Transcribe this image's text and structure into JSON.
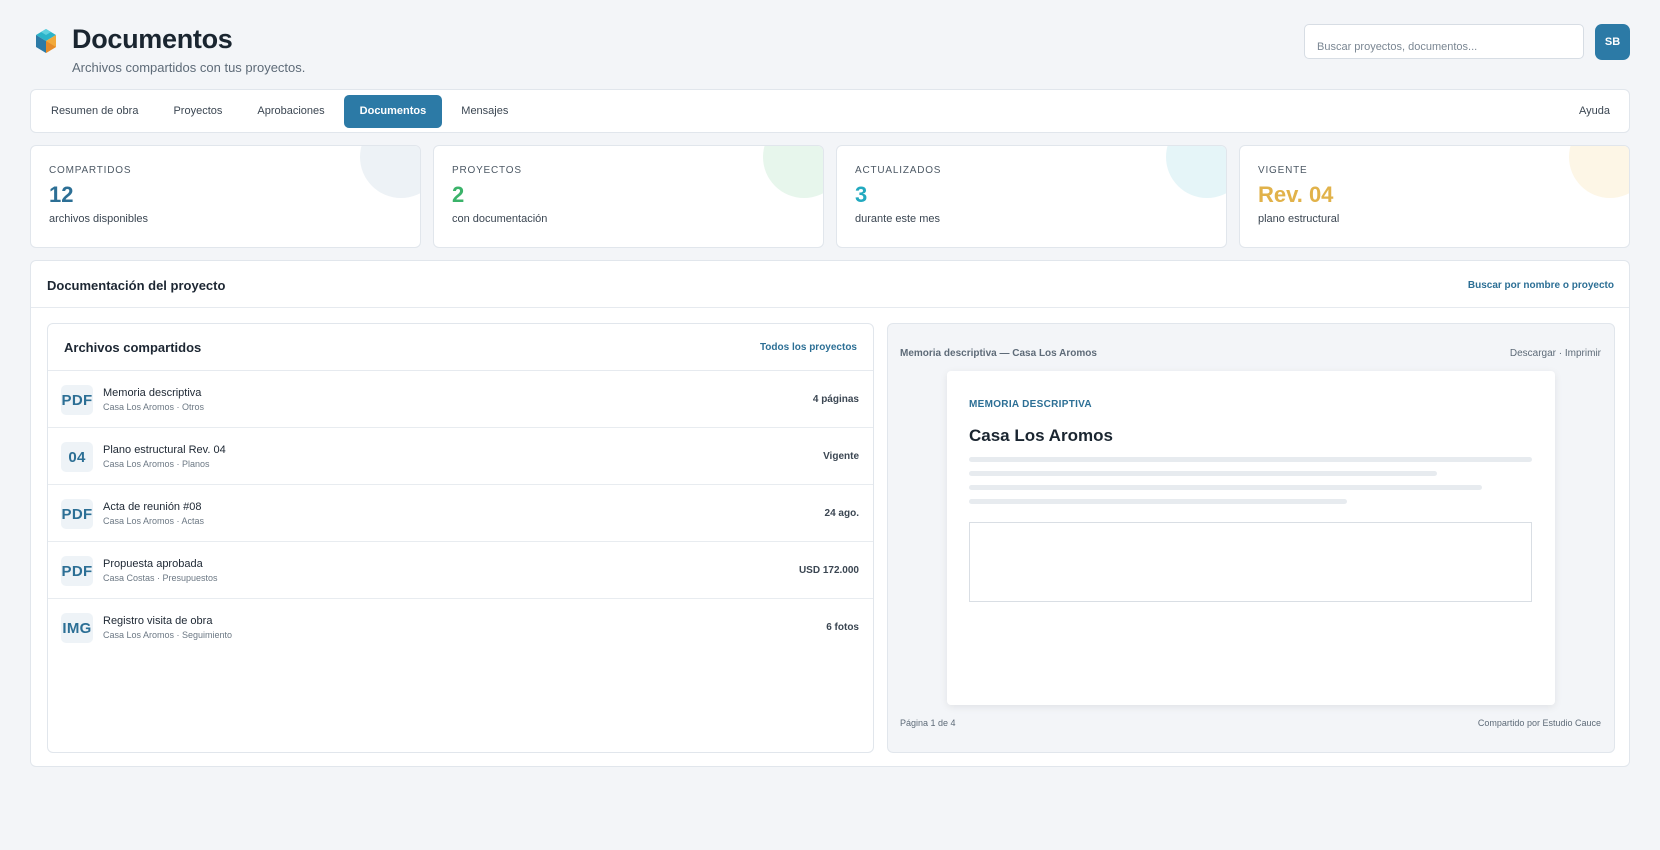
{
  "header": {
    "title": "Documentos",
    "subtitle": "Archivos compartidos con tus proyectos.",
    "search_placeholder": "Buscar proyectos, documentos...",
    "avatar_initials": "SB"
  },
  "nav": {
    "items": [
      "Resumen de obra",
      "Proyectos",
      "Aprobaciones",
      "Documentos",
      "Mensajes"
    ],
    "active": "Documentos",
    "help": "Ayuda"
  },
  "stats": [
    {
      "label": "COMPARTIDOS",
      "value": "12",
      "desc": "archivos disponibles",
      "color": "#2c6f95",
      "blob": "#edf2f6"
    },
    {
      "label": "PROYECTOS",
      "value": "2",
      "desc": "con documentación",
      "color": "#3bb36a",
      "blob": "#e7f6ec"
    },
    {
      "label": "ACTUALIZADOS",
      "value": "3",
      "desc": "durante este mes",
      "color": "#22a9bf",
      "blob": "#e5f5f8"
    },
    {
      "label": "VIGENTE",
      "value": "Rev. 04",
      "desc": "plano estructural",
      "color": "#e1b24a",
      "blob": "#fdf6e6"
    }
  ],
  "panel": {
    "title": "Documentación del proyecto",
    "link": "Buscar por nombre o proyecto"
  },
  "files": {
    "title": "Archivos compartidos",
    "link": "Todos los proyectos",
    "rows": [
      {
        "badge": "PDF",
        "name": "Memoria descriptiva",
        "meta": "Casa Los Aromos · Otros",
        "right": "4 páginas"
      },
      {
        "badge": "04",
        "name": "Plano estructural Rev. 04",
        "meta": "Casa Los Aromos · Planos",
        "right": "Vigente"
      },
      {
        "badge": "PDF",
        "name": "Acta de reunión #08",
        "meta": "Casa Los Aromos · Actas",
        "right": "24 ago."
      },
      {
        "badge": "PDF",
        "name": "Propuesta aprobada",
        "meta": "Casa Costas · Presupuestos",
        "right": "USD 172.000"
      },
      {
        "badge": "IMG",
        "name": "Registro visita de obra",
        "meta": "Casa Los Aromos · Seguimiento",
        "right": "6 fotos"
      }
    ]
  },
  "viewer": {
    "title": "Memoria descriptiva — Casa Los Aromos",
    "download": "Descargar",
    "separator": " · ",
    "print": "Imprimir",
    "doc_kicker": "MEMORIA DESCRIPTIVA",
    "doc_title": "Casa Los Aromos",
    "page": "Página 1 de 4",
    "shared_by": "Compartido por Estudio Cauce"
  }
}
